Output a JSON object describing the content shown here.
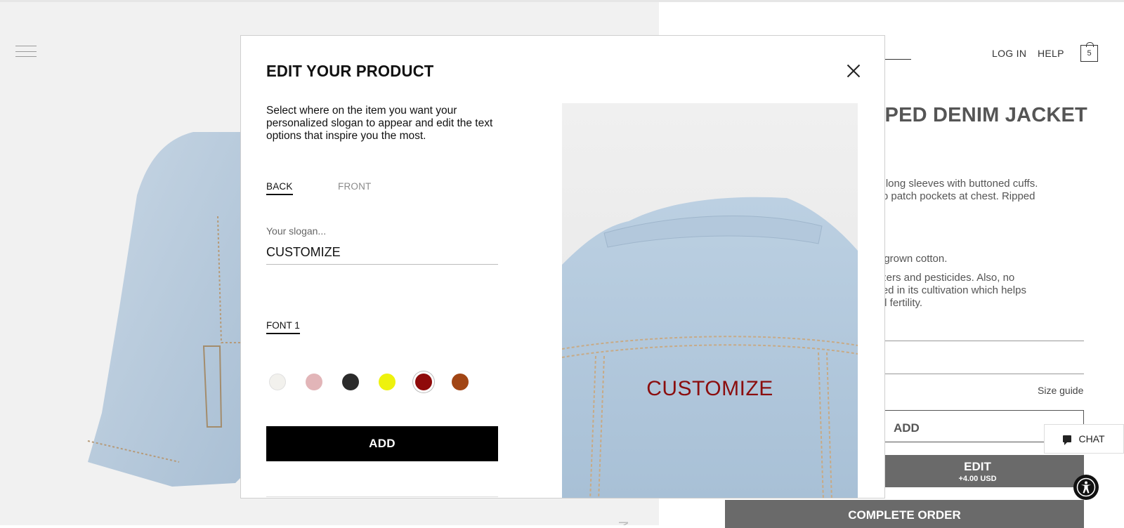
{
  "header": {
    "nav_links": [
      "LOG IN",
      "HELP"
    ],
    "cart_count": "5"
  },
  "product": {
    "title_fragment": "PPED DENIM JACKET",
    "description_lines": [
      "nd long sleeves with buttoned cuffs.",
      "flap patch pockets at chest. Ripped"
    ],
    "care_line_1": "lly grown cotton.",
    "care_lines": [
      "tilizers and pesticides. Also, no",
      "used in its cultivation which helps",
      " soil fertility."
    ],
    "size_guide_label": "Size guide",
    "add_label": "ADD",
    "edit_label": "EDIT",
    "edit_price": "+4.00 USD",
    "complete_order_label": "COMPLETE ORDER"
  },
  "chat": {
    "label": "CHAT"
  },
  "modal": {
    "title": "EDIT YOUR PRODUCT",
    "description": "Select where on the item you want your personalized slogan to appear and edit the text options that inspire you the most.",
    "tabs": [
      {
        "label": "BACK",
        "active": true
      },
      {
        "label": "FRONT",
        "active": false
      }
    ],
    "slogan_label": "Your slogan...",
    "slogan_value": "CUSTOMIZE",
    "font_label": "FONT 1",
    "colors": [
      {
        "name": "off-white",
        "hex": "#f2f1ed",
        "selected": false
      },
      {
        "name": "pink",
        "hex": "#e2b5b8",
        "selected": false
      },
      {
        "name": "black",
        "hex": "#2b2b2b",
        "selected": false
      },
      {
        "name": "yellow",
        "hex": "#eef20d",
        "selected": false
      },
      {
        "name": "dark-red",
        "hex": "#8f0a0a",
        "selected": true
      },
      {
        "name": "rust",
        "hex": "#a14514",
        "selected": false
      }
    ],
    "add_button_label": "ADD",
    "preview_text": "CUSTOMIZE",
    "preview_text_color": "#8b0e0e"
  },
  "icons": {
    "menu": "hamburger-menu-icon",
    "cart": "shopping-bag-icon",
    "close": "close-icon",
    "chat": "chat-bubble-icon",
    "accessibility": "accessibility-icon"
  }
}
